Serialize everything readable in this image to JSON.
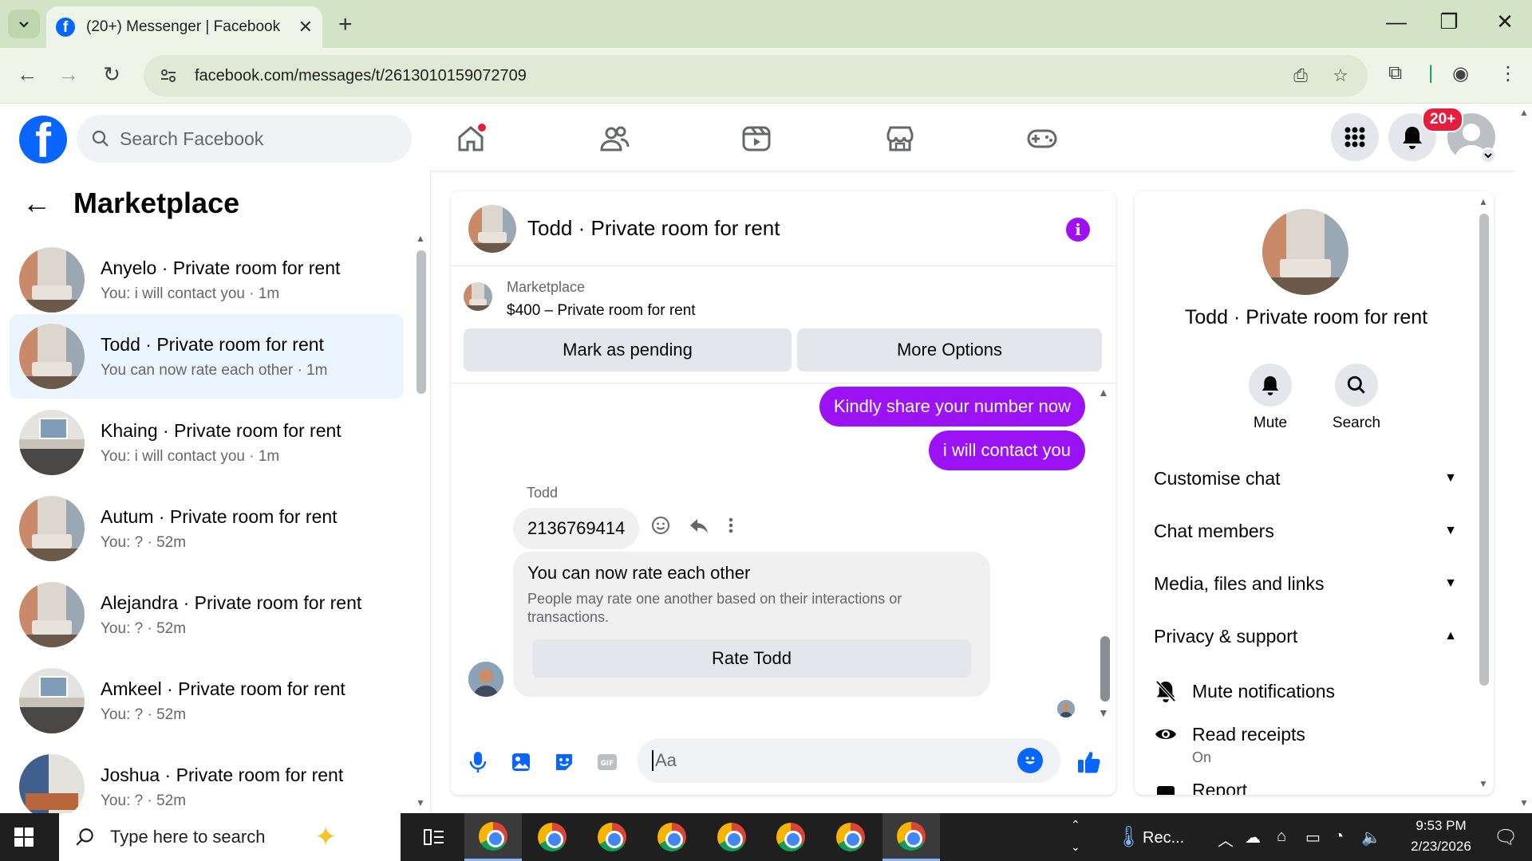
{
  "browser": {
    "tab_title": "(20+) Messenger | Facebook",
    "url": "facebook.com/messages/t/2613010159072709"
  },
  "fb_header": {
    "search_placeholder": "Search Facebook",
    "notification_badge": "20+",
    "nav_icons": [
      "home-icon",
      "friends-icon",
      "video-icon",
      "marketplace-icon",
      "gaming-icon"
    ],
    "accent": "#0866ff"
  },
  "sidebar": {
    "title": "Marketplace",
    "conversations": [
      {
        "name": "Anyelo · Private room for rent",
        "preview": "You: i will contact you · 1m",
        "thumb": "room",
        "active": false
      },
      {
        "name": "Todd · Private room for rent",
        "preview": "You can now rate each other · 1m",
        "thumb": "room",
        "active": true
      },
      {
        "name": "Khaing · Private room for rent",
        "preview": "You: i will contact you · 1m",
        "thumb": "room2",
        "active": false
      },
      {
        "name": "Autum · Private room for rent",
        "preview": "You: ? · 52m",
        "thumb": "room",
        "active": false
      },
      {
        "name": "Alejandra · Private room for rent",
        "preview": "You: ? · 52m",
        "thumb": "room",
        "active": false
      },
      {
        "name": "Amkeel · Private room for rent",
        "preview": "You: ? · 52m",
        "thumb": "room2",
        "active": false
      },
      {
        "name": "Joshua · Private room for rent",
        "preview": "You: ? · 52m",
        "thumb": "room3",
        "active": false
      }
    ]
  },
  "chat": {
    "title": "Todd · Private room for rent",
    "marketplace_label": "Marketplace",
    "listing": "$400 – Private room for rent",
    "mark_pending": "Mark as pending",
    "more_options": "More Options",
    "my_messages": [
      "Kindly share your number now",
      "i will contact you"
    ],
    "sender": "Todd",
    "their_message": "2136769414",
    "rate_title": "You can now rate each other",
    "rate_desc": "People may rate one another based on their interactions or transactions.",
    "rate_button": "Rate Todd",
    "composer_placeholder": "Aa",
    "bubble_color": "#9b12f5"
  },
  "info_panel": {
    "title": "Todd · Private room for rent",
    "actions": [
      {
        "label": "Mute"
      },
      {
        "label": "Search"
      }
    ],
    "sections": [
      {
        "label": "Customise chat",
        "expanded": false
      },
      {
        "label": "Chat members",
        "expanded": false
      },
      {
        "label": "Media, files and links",
        "expanded": false
      },
      {
        "label": "Privacy & support",
        "expanded": true
      }
    ],
    "mute_notifications": "Mute notifications",
    "read_receipts": "Read receipts",
    "read_receipts_value": "On",
    "report": "Report"
  },
  "taskbar": {
    "search_placeholder": "Type here to search",
    "tray_app": "Rec...",
    "time": "9:53 PM",
    "date": "2/23/2026"
  }
}
